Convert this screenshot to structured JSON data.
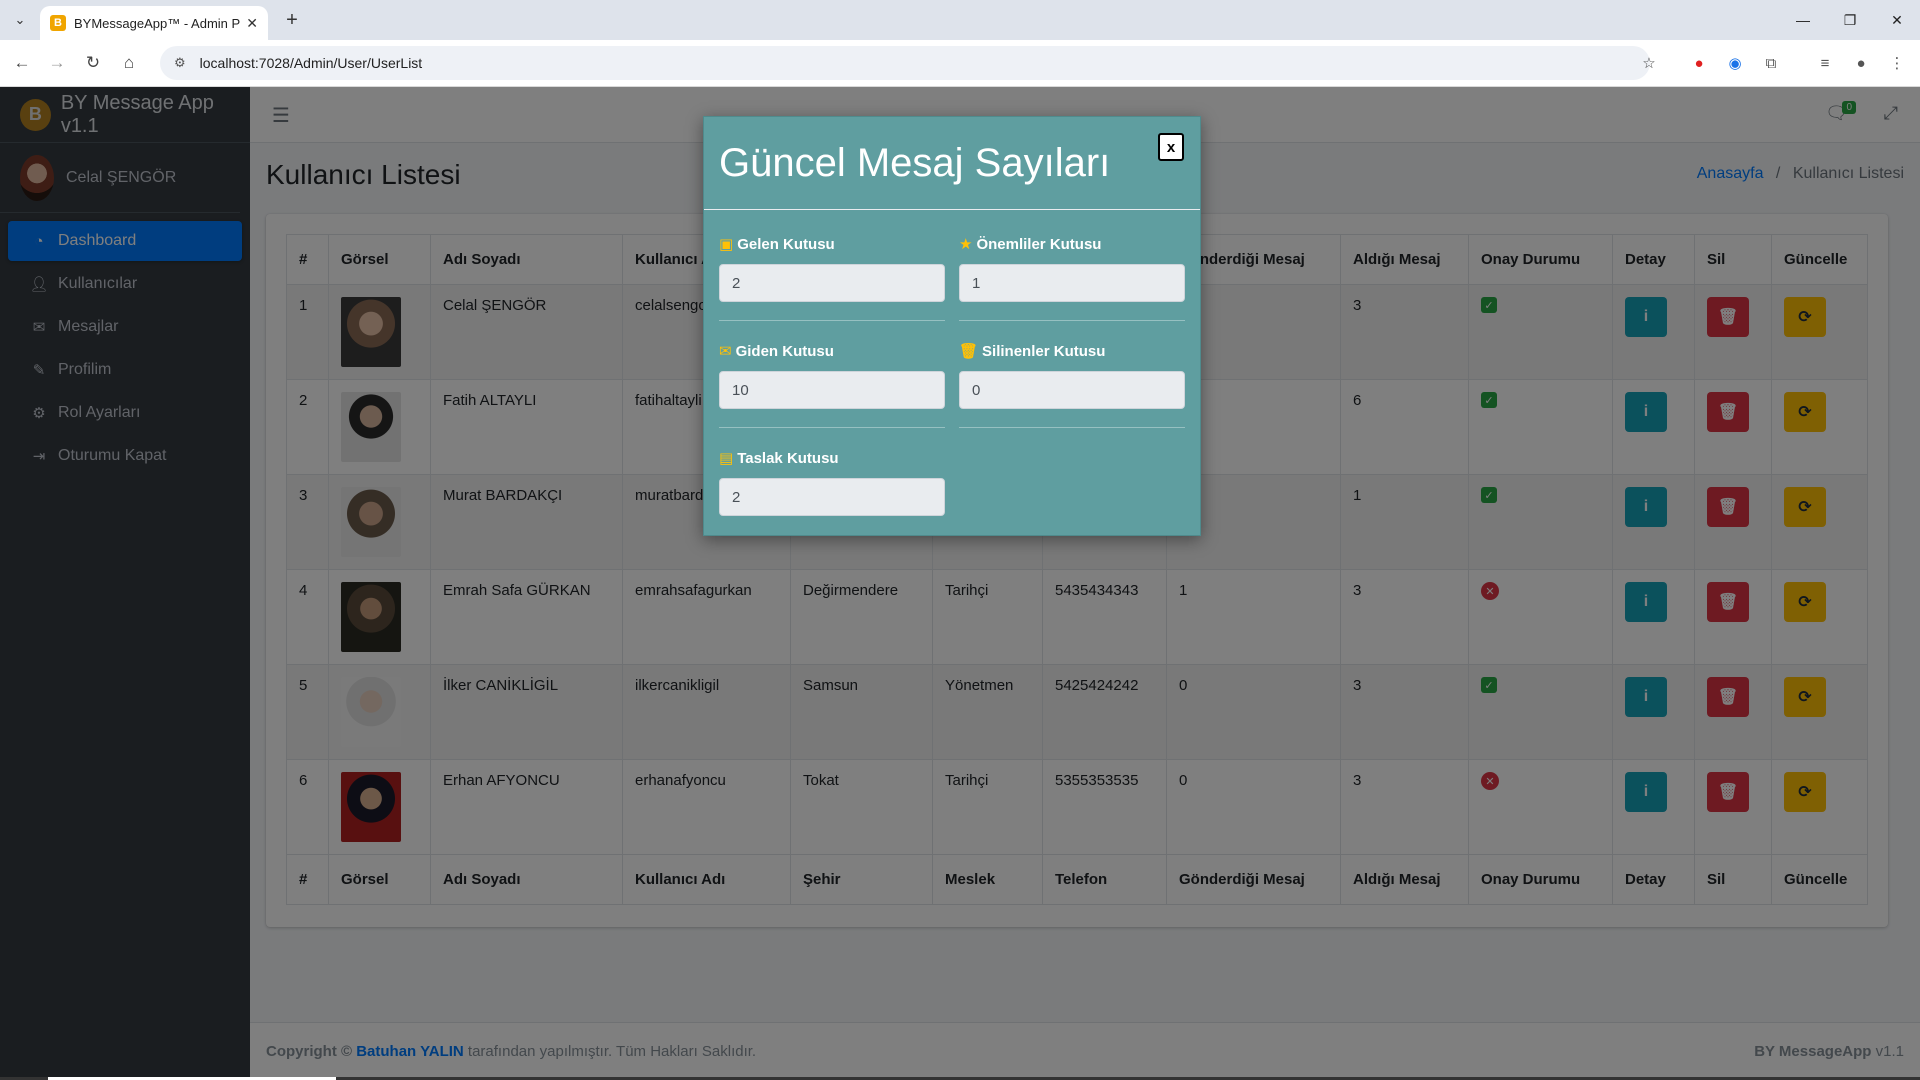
{
  "browser": {
    "tab_title": "BYMessageApp™ - Admin Panel",
    "url": "localhost:7028/Admin/User/UserList"
  },
  "sidebar": {
    "brand": "BY Message App v1.1",
    "user_name": "Celal ŞENGÖR",
    "items": [
      {
        "label": "Dashboard",
        "icon": "dashboard-icon"
      },
      {
        "label": "Kullanıcılar",
        "icon": "user-icon"
      },
      {
        "label": "Mesajlar",
        "icon": "envelope-icon"
      },
      {
        "label": "Profilim",
        "icon": "user-edit-icon"
      },
      {
        "label": "Rol Ayarları",
        "icon": "cogs-icon"
      },
      {
        "label": "Oturumu Kapat",
        "icon": "sign-out-icon"
      }
    ]
  },
  "header": {
    "chat_badge": "0"
  },
  "page": {
    "title": "Kullanıcı Listesi",
    "breadcrumb_home": "Anasayfa",
    "breadcrumb_current": "Kullanıcı Listesi"
  },
  "table": {
    "headers": [
      "#",
      "Görsel",
      "Adı Soyadı",
      "Kullanıcı Adı",
      "Şehir",
      "Meslek",
      "Telefon",
      "Gönderdiği Mesaj",
      "Aldığı Mesaj",
      "Onay Durumu",
      "Detay",
      "Sil",
      "Güncelle"
    ],
    "rows": [
      {
        "no": "1",
        "name": "Celal ŞENGÖR",
        "username": "celalsengor",
        "city": "",
        "job": "",
        "phone": "",
        "sent": "",
        "received": "3",
        "approved": true
      },
      {
        "no": "2",
        "name": "Fatih ALTAYLI",
        "username": "fatihaltayli",
        "city": "",
        "job": "",
        "phone": "",
        "sent": "",
        "received": "6",
        "approved": true
      },
      {
        "no": "3",
        "name": "Murat BARDAKÇI",
        "username": "muratbardakci",
        "city": "",
        "job": "",
        "phone": "",
        "sent": "",
        "received": "1",
        "approved": true
      },
      {
        "no": "4",
        "name": "Emrah Safa GÜRKAN",
        "username": "emrahsafagurkan",
        "city": "Değirmendere",
        "job": "Tarihçi",
        "phone": "5435434343",
        "sent": "1",
        "received": "3",
        "approved": false
      },
      {
        "no": "5",
        "name": "İlker CANİKLİGİL",
        "username": "ilkercanikligil",
        "city": "Samsun",
        "job": "Yönetmen",
        "phone": "5425424242",
        "sent": "0",
        "received": "3",
        "approved": true
      },
      {
        "no": "6",
        "name": "Erhan AFYONCU",
        "username": "erhanafyoncu",
        "city": "Tokat",
        "job": "Tarihçi",
        "phone": "5355353535",
        "sent": "0",
        "received": "3",
        "approved": false
      }
    ],
    "detail_label": "i"
  },
  "footer": {
    "copyright_prefix": "Copyright ©",
    "author": "Batuhan YALIN",
    "copyright_suffix": "tarafından yapılmıştır. Tüm Hakları Saklıdır.",
    "app_name": "BY MessageApp",
    "version": "v1.1"
  },
  "modal": {
    "title": "Güncel Mesaj Sayıları",
    "close_label": "x",
    "fields": [
      {
        "label": "Gelen Kutusu",
        "value": "2",
        "icon": "inbox-icon"
      },
      {
        "label": "Önemliler Kutusu",
        "value": "1",
        "icon": "star-icon"
      },
      {
        "label": "Giden Kutusu",
        "value": "10",
        "icon": "envelope-icon"
      },
      {
        "label": "Silinenler Kutusu",
        "value": "0",
        "icon": "trash-icon"
      },
      {
        "label": "Taslak Kutusu",
        "value": "2",
        "icon": "file-icon"
      }
    ]
  },
  "colors": {
    "sidebar_bg": "#343a40",
    "active": "#007bff",
    "modal_bg": "#5f9ea0",
    "info": "#17a2b8",
    "danger": "#dc3545",
    "warning": "#ffc107",
    "success": "#28a745"
  }
}
